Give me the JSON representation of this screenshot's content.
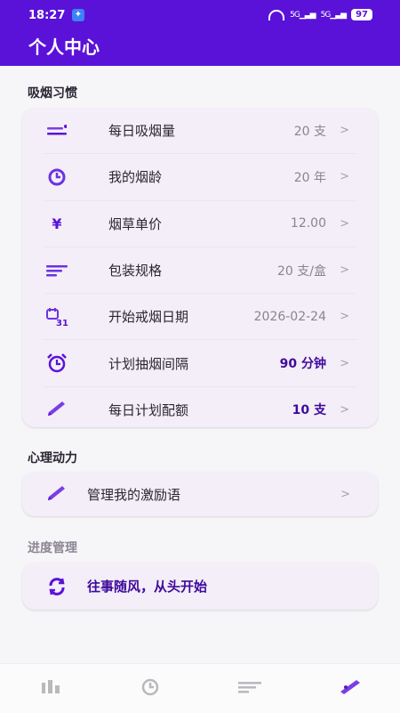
{
  "status_bar": {
    "time": "18:27",
    "network_1": "5G",
    "network_2": "5G",
    "battery": "97"
  },
  "header": {
    "title": "个人中心"
  },
  "sections": {
    "smoking_habits": "吸烟习惯",
    "motivation": "心理动力",
    "progress": "进度管理"
  },
  "smoking_habits_items": [
    {
      "label": "每日吸烟量",
      "value": "20 支",
      "icon": "daily-smoke-icon"
    },
    {
      "label": "我的烟龄",
      "value": "20 年",
      "icon": "clock-icon"
    },
    {
      "label": "烟草单价",
      "value": "12.00",
      "icon": "yuan-icon"
    },
    {
      "label": "包装规格",
      "value": "20 支/盒",
      "icon": "package-lines-icon"
    },
    {
      "label": "开始戒烟日期",
      "value": "2026-02-24",
      "icon": "calendar-icon"
    },
    {
      "label": "计划抽烟间隔",
      "value": "90 分钟",
      "icon": "alarm-clock-icon"
    },
    {
      "label": "每日计划配额",
      "value": "10 支",
      "icon": "pencil-icon"
    }
  ],
  "motivation_item": {
    "label": "管理我的激励语",
    "icon": "pencil-icon"
  },
  "progress_item": {
    "label": "往事随风，从头开始",
    "icon": "refresh-icon"
  },
  "colors": {
    "accent": "#5a12d9",
    "accent_dark": "#3f0a9c",
    "card": "#f3eef7"
  }
}
